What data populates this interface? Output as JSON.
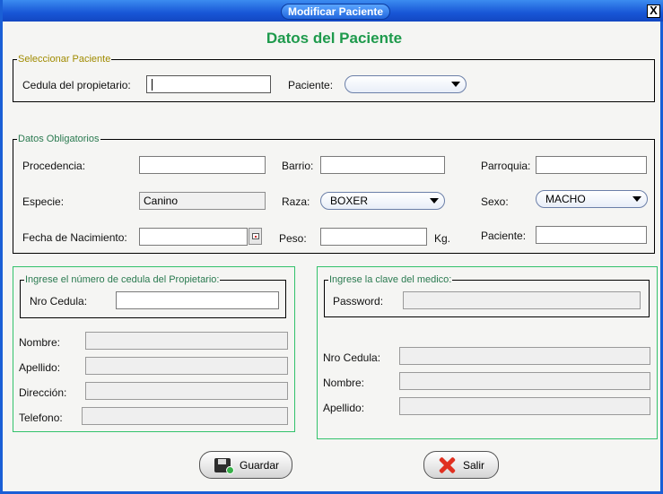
{
  "window": {
    "title": "Modificar Paciente",
    "close_glyph": "X"
  },
  "heading": "Datos del Paciente",
  "select_patient": {
    "legend": "Seleccionar Paciente",
    "cedula_label": "Cedula del propietario:",
    "cedula_value": "",
    "paciente_label": "Paciente:",
    "paciente_value": ""
  },
  "mandatory": {
    "legend": "Datos Obligatorios",
    "procedencia_label": "Procedencia:",
    "barrio_label": "Barrio:",
    "parroquia_label": "Parroquia:",
    "especie_label": "Especie:",
    "especie_value": "Canino",
    "raza_label": "Raza:",
    "raza_value": "BOXER",
    "sexo_label": "Sexo:",
    "sexo_value": "MACHO",
    "fecha_label": "Fecha de Nacimiento:",
    "peso_label": "Peso:",
    "peso_unit": "Kg.",
    "paciente_label": "Paciente:"
  },
  "owner": {
    "legend": "Ingrese el número de cedula del Propietario:",
    "nro_cedula_label": "Nro Cedula:",
    "nombre_label": "Nombre:",
    "apellido_label": "Apellido:",
    "direccion_label": "Dirección:",
    "telefono_label": "Telefono:"
  },
  "doctor": {
    "legend": "Ingrese la clave del medico:",
    "password_label": "Password:",
    "nro_cedula_label": "Nro Cedula:",
    "nombre_label": "Nombre:",
    "apellido_label": "Apellido:"
  },
  "buttons": {
    "save_label": "Guardar",
    "exit_label": "Salir"
  },
  "icons": {
    "save": "floppy-disk-icon",
    "exit": "red-x-icon",
    "calendar": "calendar-icon",
    "dropdown": "chevron-down-icon"
  },
  "colors": {
    "title_bar": "#1856d6",
    "heading": "#1e9a4c",
    "group_border_green": "#33c26b",
    "group_border_yellow": "#c8b400"
  }
}
